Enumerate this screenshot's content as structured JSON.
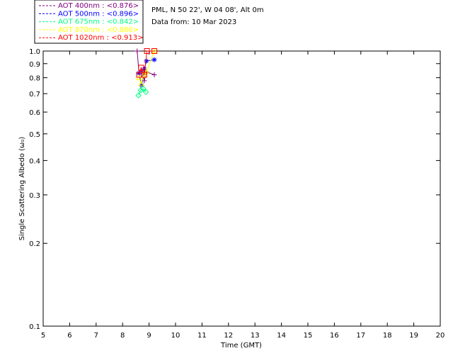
{
  "chart_data": {
    "type": "scatter",
    "header": [
      "PML, N 50 22', W 04 08', Alt 0m",
      "Data from: 10 Mar 2023"
    ],
    "xlabel": "Time (GMT)",
    "ylabel": "Single Scattering Albedo (ω₀)",
    "xlim": [
      5,
      20
    ],
    "ylim": [
      0.1,
      1.0
    ],
    "yscale": "log",
    "xticks": [
      "5",
      "6",
      "7",
      "8",
      "9",
      "10",
      "11",
      "12",
      "13",
      "14",
      "15",
      "16",
      "17",
      "18",
      "19",
      "20"
    ],
    "yticks": [
      "0.1",
      "0.2",
      "0.3",
      "0.4",
      "0.5",
      "0.6",
      "0.7",
      "0.8",
      "0.9",
      "1.0"
    ],
    "yticks_values": [
      0.1,
      0.2,
      0.3,
      0.4,
      0.5,
      0.6,
      0.7,
      0.8,
      0.9,
      1.0
    ],
    "series": [
      {
        "name": "AOT  400nm : <0.876>",
        "color": "#800080",
        "marker": "plus",
        "x": [
          8.55,
          8.62,
          8.72,
          8.82,
          8.9,
          9.2
        ],
        "y": [
          1.0,
          0.83,
          0.85,
          0.78,
          0.84,
          0.82
        ]
      },
      {
        "name": "AOT  500nm : <0.896>",
        "color": "#0000ff",
        "marker": "asterisk",
        "x": [
          8.62,
          8.72,
          8.82,
          8.9,
          9.2
        ],
        "y": [
          0.83,
          0.75,
          0.86,
          0.92,
          0.93
        ]
      },
      {
        "name": "AOT  675nm : <0.842>",
        "color": "#00ff80",
        "marker": "diamond",
        "x": [
          8.6,
          8.68,
          8.78,
          8.88
        ],
        "y": [
          0.69,
          0.72,
          0.73,
          0.71
        ]
      },
      {
        "name": "AOT  870nm : <0.886>",
        "color": "#ffff00",
        "marker": "triangle",
        "x": [
          8.62,
          8.7,
          8.8,
          8.9,
          9.2
        ],
        "y": [
          0.8,
          0.76,
          0.82,
          0.84,
          1.0
        ]
      },
      {
        "name": "AOT 1020nm : <0.913>",
        "color": "#ff0000",
        "marker": "square",
        "x": [
          8.62,
          8.7,
          8.82,
          8.92,
          9.2
        ],
        "y": [
          0.82,
          0.87,
          0.82,
          1.0,
          1.0
        ]
      }
    ]
  }
}
